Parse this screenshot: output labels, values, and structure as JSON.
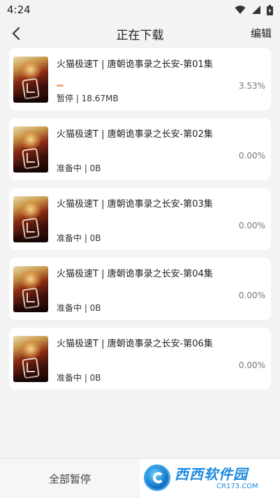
{
  "status_bar": {
    "time": "4:24",
    "icons": [
      "wifi-icon",
      "signal-icon",
      "battery-icon"
    ]
  },
  "header": {
    "title": "正在下载",
    "edit_label": "编辑",
    "back_icon": "chevron-left-icon"
  },
  "downloads": [
    {
      "title": "火猫极速T | 唐朝诡事录之长安-第01集",
      "status": "暂停 | 18.67MB",
      "percent": "3.53%",
      "progress": 0.0353
    },
    {
      "title": "火猫极速T | 唐朝诡事录之长安-第02集",
      "status": "准备中 | 0B",
      "percent": "0.00%",
      "progress": 0
    },
    {
      "title": "火猫极速T | 唐朝诡事录之长安-第03集",
      "status": "准备中 | 0B",
      "percent": "0.00%",
      "progress": 0
    },
    {
      "title": "火猫极速T | 唐朝诡事录之长安-第04集",
      "status": "准备中 | 0B",
      "percent": "0.00%",
      "progress": 0
    },
    {
      "title": "火猫极速T | 唐朝诡事录之长安-第06集",
      "status": "准备中 | 0B",
      "percent": "0.00%",
      "progress": 0
    }
  ],
  "footer": {
    "pause_all_label": "全部暂停",
    "watermark_text": "西西软件园",
    "watermark_url": "CR173.COM"
  },
  "colors": {
    "background": "#f3f3f3",
    "card": "#ffffff",
    "progress": "#f2a77a",
    "watermark_blue": "#1e8be0"
  }
}
